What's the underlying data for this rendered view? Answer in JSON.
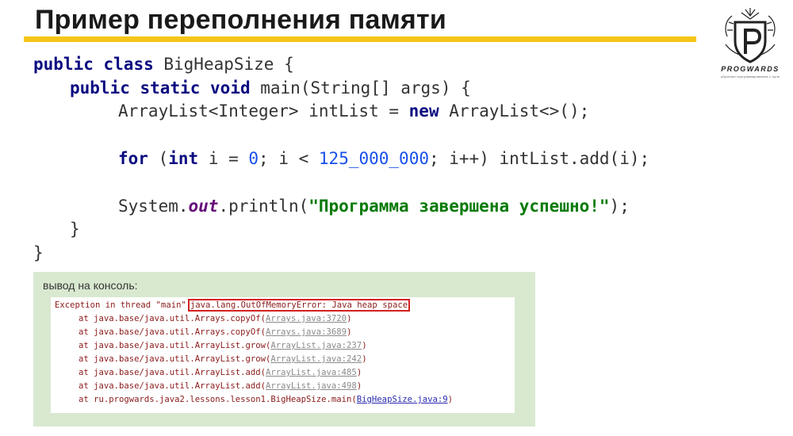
{
  "header": {
    "title": "Пример переполнения памяти",
    "logo_name": "PROGWARDS",
    "logo_tag": "обучение программированию с нуля"
  },
  "code": {
    "l1_kw1": "public",
    "l1_kw2": "class",
    "l1_rest": " BigHeapSize {",
    "l2_kw1": "public",
    "l2_kw2": "static",
    "l2_kw3": "void",
    "l2_rest": " main(String[] args) {",
    "l3_a": "ArrayList<Integer> intList = ",
    "l3_kw": "new",
    "l3_b": " ArrayList<>();",
    "l4_kw1": "for",
    "l4_a": " (",
    "l4_kw2": "int",
    "l4_b": " i = ",
    "l4_n1": "0",
    "l4_c": "; i < ",
    "l4_n2": "125_000_000",
    "l4_d": "; i++) intList.add(i);",
    "l5_a": "System.",
    "l5_fld": "out",
    "l5_b": ".println(",
    "l5_str": "\"Программа завершена успешно!\"",
    "l5_c": ");",
    "l6": "}",
    "l7": "}"
  },
  "console": {
    "label": "вывод на консоль:",
    "exception_prefix": "Exception in thread \"main\"",
    "exception_error": "java.lang.OutOfMemoryError: Java heap space",
    "frames": [
      {
        "at": "at java.base/java.util.Arrays.copyOf(",
        "link": "Arrays.java:3720",
        "end": ")"
      },
      {
        "at": "at java.base/java.util.Arrays.copyOf(",
        "link": "Arrays.java:3689",
        "end": ")"
      },
      {
        "at": "at java.base/java.util.ArrayList.grow(",
        "link": "ArrayList.java:237",
        "end": ")"
      },
      {
        "at": "at java.base/java.util.ArrayList.grow(",
        "link": "ArrayList.java:242",
        "end": ")"
      },
      {
        "at": "at java.base/java.util.ArrayList.add(",
        "link": "ArrayList.java:485",
        "end": ")"
      },
      {
        "at": "at java.base/java.util.ArrayList.add(",
        "link": "ArrayList.java:498",
        "end": ")"
      },
      {
        "at": "at ru.progwards.java2.lessons.lesson1.BigHeapSize.main(",
        "link": "BigHeapSize.java:9",
        "end": ")"
      }
    ]
  },
  "colors": {
    "accent_bar": "#f5c518",
    "console_bg": "#d9e9d0",
    "keyword": "#0a0a80",
    "number": "#1750eb",
    "string": "#087a08",
    "error_box": "#d42020"
  }
}
